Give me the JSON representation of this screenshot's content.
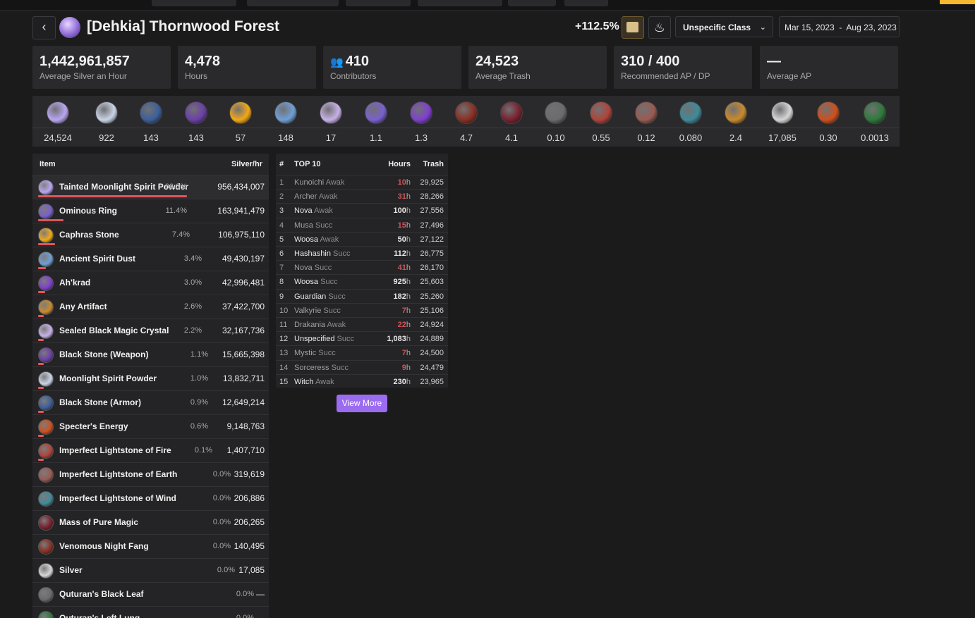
{
  "header": {
    "title": "[Dehkia] Thornwood Forest",
    "bonus_percent": "+112.5%",
    "class_select": "Unspecific Class",
    "date_start": "Mar 15, 2023",
    "date_sep": "-",
    "date_end": "Aug 23, 2023",
    "back_icon": "chevron-left-icon"
  },
  "stats": [
    {
      "value": "1,442,961,857",
      "label": "Average Silver an Hour"
    },
    {
      "value": "4,478",
      "label": "Hours"
    },
    {
      "value": "410",
      "label": "Contributors",
      "icon": "people-icon"
    },
    {
      "value": "24,523",
      "label": "Average Trash"
    },
    {
      "value": "310 / 400",
      "label": "Recommended AP / DP"
    },
    {
      "value": "—",
      "label": "Average AP"
    }
  ],
  "drops": [
    {
      "value": "24,524",
      "color": "#b9a6f2"
    },
    {
      "value": "922",
      "color": "#c9d4e6"
    },
    {
      "value": "143",
      "color": "#3b5f9a"
    },
    {
      "value": "143",
      "color": "#6b3fa8"
    },
    {
      "value": "57",
      "color": "#f2a817"
    },
    {
      "value": "148",
      "color": "#6f9fd6"
    },
    {
      "value": "17",
      "color": "#c8b1e6"
    },
    {
      "value": "1.1",
      "color": "#7a5fd0"
    },
    {
      "value": "1.3",
      "color": "#7f3fcf"
    },
    {
      "value": "4.7",
      "color": "#8a2e22"
    },
    {
      "value": "4.1",
      "color": "#7a1f2e"
    },
    {
      "value": "0.10",
      "color": "#6b6b6b"
    },
    {
      "value": "0.55",
      "color": "#b0443a"
    },
    {
      "value": "0.12",
      "color": "#9a5a52"
    },
    {
      "value": "0.080",
      "color": "#3f8a9a"
    },
    {
      "value": "2.4",
      "color": "#c98a2a"
    },
    {
      "value": "17,085",
      "color": "#d6d6d6"
    },
    {
      "value": "0.30",
      "color": "#d04f1c"
    },
    {
      "value": "0.0013",
      "color": "#2d7a3a"
    }
  ],
  "items_table": {
    "col_item": "Item",
    "col_silver": "Silver/hr",
    "rows": [
      {
        "name": "Tainted Moonlight Spirit Powder",
        "pct": "66.3%",
        "silver": "956,434,007",
        "share": 0.663,
        "color": "#b9a6f2"
      },
      {
        "name": "Ominous Ring",
        "pct": "11.4%",
        "silver": "163,941,479",
        "share": 0.114,
        "color": "#7a5fd0"
      },
      {
        "name": "Caphras Stone",
        "pct": "7.4%",
        "silver": "106,975,110",
        "share": 0.074,
        "color": "#f2a817"
      },
      {
        "name": "Ancient Spirit Dust",
        "pct": "3.4%",
        "silver": "49,430,197",
        "share": 0.034,
        "color": "#6f9fd6"
      },
      {
        "name": "Ah'krad",
        "pct": "3.0%",
        "silver": "42,996,481",
        "share": 0.03,
        "color": "#7f3fcf"
      },
      {
        "name": "Any Artifact",
        "pct": "2.6%",
        "silver": "37,422,700",
        "share": 0.026,
        "color": "#c98a2a"
      },
      {
        "name": "Sealed Black Magic Crystal",
        "pct": "2.2%",
        "silver": "32,167,736",
        "share": 0.022,
        "color": "#c8b1e6"
      },
      {
        "name": "Black Stone (Weapon)",
        "pct": "1.1%",
        "silver": "15,665,398",
        "share": 0.011,
        "color": "#6b3fa8"
      },
      {
        "name": "Moonlight Spirit Powder",
        "pct": "1.0%",
        "silver": "13,832,711",
        "share": 0.01,
        "color": "#c9d4e6"
      },
      {
        "name": "Black Stone (Armor)",
        "pct": "0.9%",
        "silver": "12,649,214",
        "share": 0.009,
        "color": "#3b5f9a"
      },
      {
        "name": "Specter's Energy",
        "pct": "0.6%",
        "silver": "9,148,763",
        "share": 0.006,
        "color": "#d04f1c"
      },
      {
        "name": "Imperfect Lightstone of Fire",
        "pct": "0.1%",
        "silver": "1,407,710",
        "share": 0.001,
        "color": "#b0443a"
      },
      {
        "name": "Imperfect Lightstone of Earth",
        "pct": "0.0%",
        "silver": "319,619",
        "share": 0.0,
        "color": "#9a5a52"
      },
      {
        "name": "Imperfect Lightstone of Wind",
        "pct": "0.0%",
        "silver": "206,886",
        "share": 0.0,
        "color": "#3f8a9a"
      },
      {
        "name": "Mass of Pure Magic",
        "pct": "0.0%",
        "silver": "206,265",
        "share": 0.0,
        "color": "#7a1f2e"
      },
      {
        "name": "Venomous Night Fang",
        "pct": "0.0%",
        "silver": "140,495",
        "share": 0.0,
        "color": "#8a2e22"
      },
      {
        "name": "Silver",
        "pct": "0.0%",
        "silver": "17,085",
        "share": 0.0,
        "color": "#d6d6d6"
      },
      {
        "name": "Quturan's Black Leaf",
        "pct": "0.0%",
        "silver": "—",
        "share": 0.0,
        "color": "#6b6b6b"
      },
      {
        "name": "Quturan's Left Lung",
        "pct": "0.0%",
        "silver": "",
        "share": 0.0,
        "color": "#2d7a3a"
      }
    ]
  },
  "top10": {
    "col_rank": "#",
    "col_title": "TOP 10",
    "col_hours": "Hours",
    "col_trash": "Trash",
    "hours_unit": "h",
    "view_more": "View More",
    "rows": [
      {
        "rank": "1",
        "class": "Kunoichi",
        "spec": "Awak",
        "hours": "10",
        "trash": "29,925",
        "dim": true
      },
      {
        "rank": "2",
        "class": "Archer",
        "spec": "Awak",
        "hours": "31",
        "trash": "28,266",
        "dim": true
      },
      {
        "rank": "3",
        "class": "Nova",
        "spec": "Awak",
        "hours": "100",
        "trash": "27,556",
        "dim": false
      },
      {
        "rank": "4",
        "class": "Musa",
        "spec": "Succ",
        "hours": "15",
        "trash": "27,496",
        "dim": true
      },
      {
        "rank": "5",
        "class": "Woosa",
        "spec": "Awak",
        "hours": "50",
        "trash": "27,122",
        "dim": false
      },
      {
        "rank": "6",
        "class": "Hashashin",
        "spec": "Succ",
        "hours": "112",
        "trash": "26,775",
        "dim": false
      },
      {
        "rank": "7",
        "class": "Nova",
        "spec": "Succ",
        "hours": "41",
        "trash": "26,170",
        "dim": true
      },
      {
        "rank": "8",
        "class": "Woosa",
        "spec": "Succ",
        "hours": "925",
        "trash": "25,603",
        "dim": false
      },
      {
        "rank": "9",
        "class": "Guardian",
        "spec": "Succ",
        "hours": "182",
        "trash": "25,260",
        "dim": false
      },
      {
        "rank": "10",
        "class": "Valkyrie",
        "spec": "Succ",
        "hours": "7",
        "trash": "25,106",
        "dim": true
      },
      {
        "rank": "11",
        "class": "Drakania",
        "spec": "Awak",
        "hours": "22",
        "trash": "24,924",
        "dim": true
      },
      {
        "rank": "12",
        "class": "Unspecified",
        "spec": "Succ",
        "hours": "1,083",
        "trash": "24,889",
        "dim": false
      },
      {
        "rank": "13",
        "class": "Mystic",
        "spec": "Succ",
        "hours": "7",
        "trash": "24,500",
        "dim": true
      },
      {
        "rank": "14",
        "class": "Sorceress",
        "spec": "Succ",
        "hours": "9",
        "trash": "24,479",
        "dim": true
      },
      {
        "rank": "15",
        "class": "Witch",
        "spec": "Awak",
        "hours": "230",
        "trash": "23,965",
        "dim": false
      }
    ]
  }
}
